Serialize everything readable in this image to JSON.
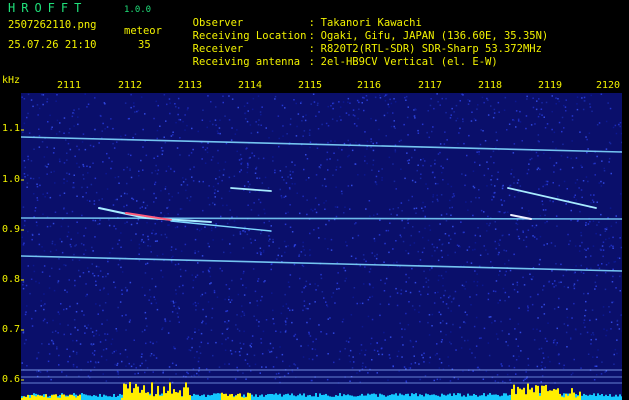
{
  "header": {
    "logo": "HROFFT",
    "version": "1.0.0",
    "filename": "2507262110.png",
    "meteor_label": "meteor",
    "meteor_count": "35",
    "datetime": "25.07.26 21:10"
  },
  "meta": {
    "observer_key": "Observer",
    "observer_value": "Takanori Kawachi",
    "location_key": "Receiving Location",
    "location_value": "Ogaki, Gifu, JAPAN (136.60E, 35.35N)",
    "receiver_key": "Receiver",
    "receiver_value": "R820T2(RTL-SDR) SDR-Sharp 53.372MHz",
    "antenna_key": "Receiving antenna",
    "antenna_value": "2el-HB9CV Vertical (el. E-W)",
    "colon": ":"
  },
  "axes": {
    "y_unit": "kHz",
    "y_ticks": [
      "1.1",
      "1.0",
      "0.9",
      "0.8",
      "0.7",
      "0.6"
    ],
    "x_ticks": [
      "2111",
      "2112",
      "2113",
      "2114",
      "2115",
      "2116",
      "2117",
      "2118",
      "2119",
      "2120"
    ]
  },
  "colors": {
    "background": "#0a0f6b",
    "trace": "#7fd8ff",
    "text_yellow": "#f2f200",
    "text_green": "#1fe07a",
    "noise_bar": "#14c8ff",
    "meteor_burst": "#ffee00"
  }
}
